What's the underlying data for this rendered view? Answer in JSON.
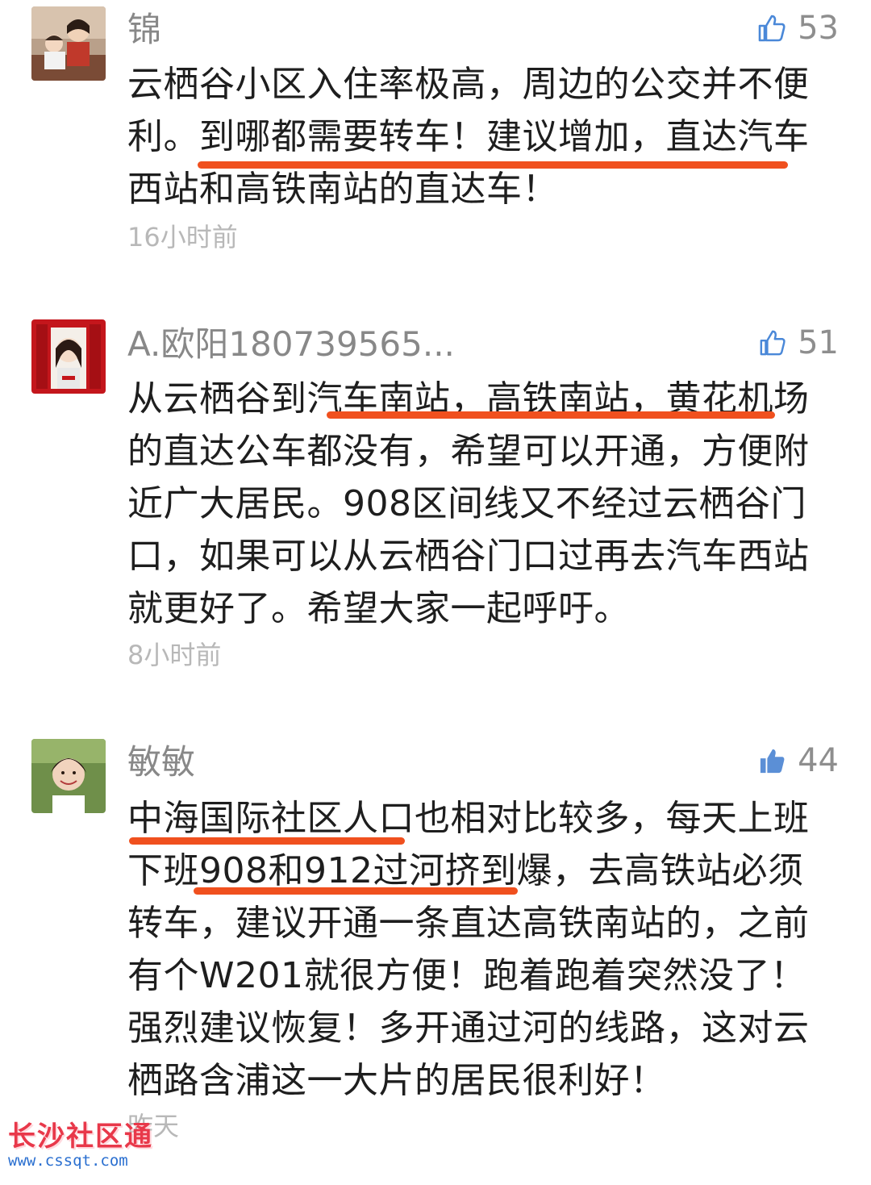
{
  "comments": [
    {
      "username": "锦",
      "likes": "53",
      "like_state": "outline",
      "text": "云栖谷小区入住率极高，周边的公交并不便利。到哪都需要转车！建议增加，直达汽车西站和高铁南站的直达车！",
      "time": "16小时前"
    },
    {
      "username": "A.欧阳180739565...",
      "likes": "51",
      "like_state": "outline",
      "text": "从云栖谷到汽车南站，高铁南站，黄花机场的直达公车都没有，希望可以开通，方便附近广大居民。908区间线又不经过云栖谷门口，如果可以从云栖谷门口过再去汽车西站就更好了。希望大家一起呼吁。",
      "time": "8小时前"
    },
    {
      "username": "敏敏",
      "likes": "44",
      "like_state": "filled",
      "text": "中海国际社区人口也相对比较多，每天上班下班908和912过河挤到爆，去高铁站必须转车，建议开通一条直达高铁南站的，之前有个W201就很方便！跑着跑着突然没了！强烈建议恢复！多开通过河的线路，这对云栖路含浦这一大片的居民很利好！",
      "time": "昨天"
    }
  ],
  "colors": {
    "highlight_underline": "#f0501e",
    "like_outline": "#4a88d8",
    "like_filled": "#5b8fd6"
  },
  "watermark": {
    "title": "长沙社区通",
    "url": "www.cssqt.com"
  }
}
